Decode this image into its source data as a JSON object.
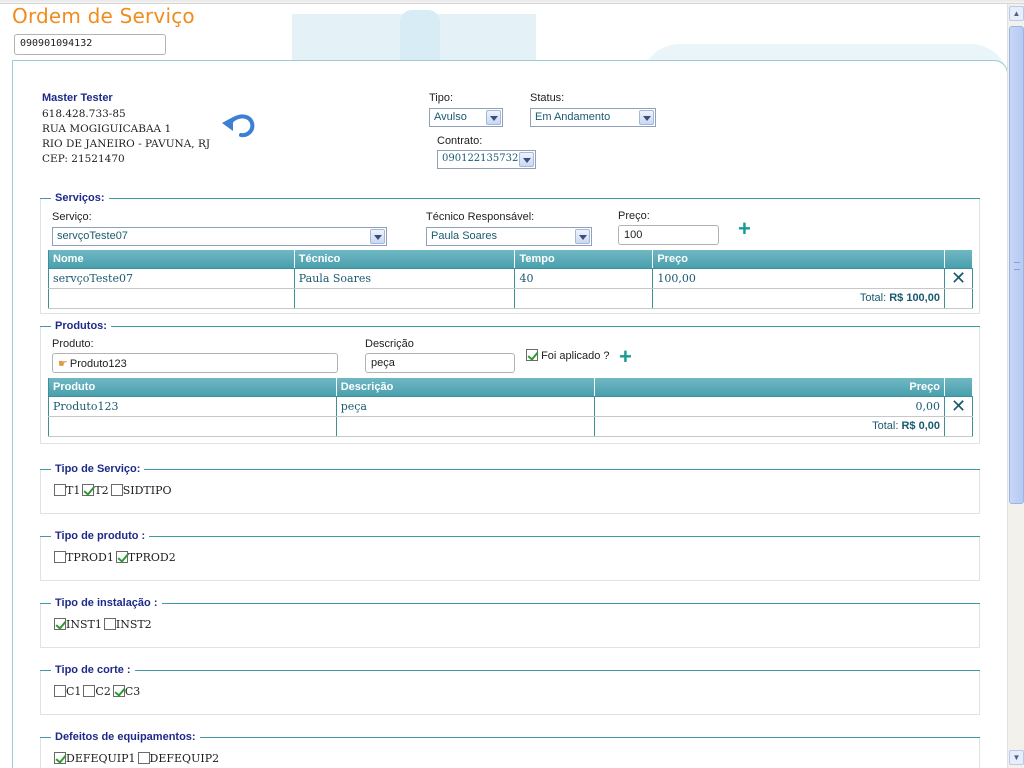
{
  "page_title": "Ordem de Serviço",
  "os_number": "090901094132",
  "customer": {
    "name": "Master Tester",
    "doc": "618.428.733-85",
    "street": "RUA MOGIGUICABAA 1",
    "city": "RIO DE JANEIRO - PAVUNA, RJ",
    "cep": "CEP: 21521470"
  },
  "header_fields": {
    "tipo_label": "Tipo:",
    "tipo_value": "Avulso",
    "status_label": "Status:",
    "status_value": "Em Andamento",
    "contrato_label": "Contrato:",
    "contrato_value": "090122135732"
  },
  "servicos": {
    "title": "Serviços:",
    "servico_label": "Serviço:",
    "servico_value": "servçoTeste07",
    "tecnico_label": "Técnico Responsável:",
    "tecnico_value": "Paula Soares",
    "preco_label": "Preço:",
    "preco_value": "100",
    "columns": [
      "Nome",
      "Técnico",
      "Tempo",
      "Preço"
    ],
    "rows": [
      {
        "nome": "servçoTeste07",
        "tecnico": "Paula Soares",
        "tempo": "40",
        "preco": "100,00"
      }
    ],
    "total_label": "Total:",
    "total_value": "R$ 100,00"
  },
  "produtos": {
    "title": "Produtos:",
    "produto_label": "Produto:",
    "produto_value": "Produto123",
    "descricao_label": "Descrição",
    "descricao_value": "peça",
    "aplicado_label": "Foi aplicado ?",
    "aplicado_checked": true,
    "columns": [
      "Produto",
      "Descrição",
      "Preço"
    ],
    "rows": [
      {
        "produto": "Produto123",
        "descricao": "peça",
        "preco": "0,00"
      }
    ],
    "total_label": "Total:",
    "total_value": "R$ 0,00"
  },
  "groups": [
    {
      "title": "Tipo de Serviço:",
      "options": [
        {
          "label": "T1",
          "checked": false
        },
        {
          "label": "T2",
          "checked": true
        },
        {
          "label": "SIDTIPO",
          "checked": false
        }
      ]
    },
    {
      "title": "Tipo de produto :",
      "options": [
        {
          "label": "TPROD1",
          "checked": false
        },
        {
          "label": "TPROD2",
          "checked": true
        }
      ]
    },
    {
      "title": "Tipo de instalação :",
      "options": [
        {
          "label": "INST1",
          "checked": true
        },
        {
          "label": "INST2",
          "checked": false
        }
      ]
    },
    {
      "title": "Tipo de corte :",
      "options": [
        {
          "label": "C1",
          "checked": false
        },
        {
          "label": "C2",
          "checked": false
        },
        {
          "label": "C3",
          "checked": true
        }
      ]
    },
    {
      "title": "Defeitos de equipamentos:",
      "options": [
        {
          "label": "DEFEQUIP1",
          "checked": true
        },
        {
          "label": "DEFEQUIP2",
          "checked": false
        }
      ]
    }
  ],
  "colors": {
    "accent_orange": "#f08c1e",
    "teal": "#3f9aa8",
    "navy": "#1d2a8a",
    "delete": "#e05a10"
  },
  "icons": {
    "back": "back-arrow-icon",
    "add": "plus-icon",
    "remove": "x-icon",
    "product": "product-hand-icon"
  }
}
